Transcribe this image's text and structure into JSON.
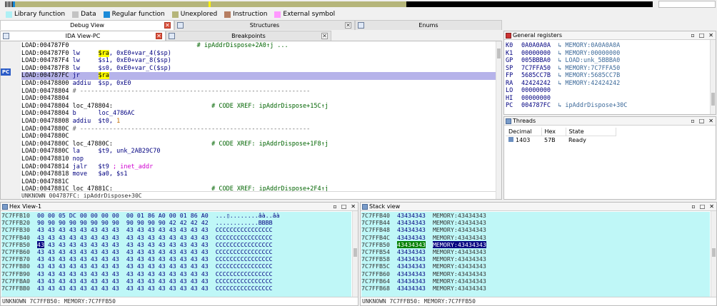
{
  "legend": [
    {
      "label": "Library function",
      "color": "#aef0f5"
    },
    {
      "label": "Data",
      "color": "#c3c3c3"
    },
    {
      "label": "Regular function",
      "color": "#1c8bd8"
    },
    {
      "label": "Unexplored",
      "color": "#b5b57a"
    },
    {
      "label": "Instruction",
      "color": "#b67e62"
    },
    {
      "label": "External symbol",
      "color": "#ff99ff"
    }
  ],
  "tabs_row1": [
    {
      "label": "Debug View",
      "active": true,
      "close": "red"
    },
    {
      "label": "Structures",
      "active": false,
      "close": "gray"
    },
    {
      "label": "Enums",
      "active": false,
      "close": "gray"
    }
  ],
  "tabs_row2": [
    {
      "label": "IDA View-PC",
      "active": true,
      "close": "red"
    },
    {
      "label": "Breakpoints",
      "active": false,
      "close": "gray"
    }
  ],
  "ida": {
    "pc_marker": "PC",
    "status": "UNKNOWN 004787FC: ipAddrDispose+30C",
    "lines": [
      [
        {
          "t": "LOAD:004787F0",
          "c": "addr"
        },
        {
          "t": "                                   # ipAddrDispose+2A0↑j ...",
          "c": "cmt"
        }
      ],
      [
        {
          "t": "LOAD:004787F0 ",
          "c": "addr"
        },
        {
          "t": "lw",
          "c": "mn"
        },
        {
          "t": "     ",
          "c": ""
        },
        {
          "t": "$ra",
          "c": "reg"
        },
        {
          "t": ", 0xE0+var_4($sp)",
          "c": "op"
        }
      ],
      [
        {
          "t": "LOAD:004787F4 ",
          "c": "addr"
        },
        {
          "t": "lw",
          "c": "mn"
        },
        {
          "t": "     $s1, 0xE0+var_8($sp)",
          "c": "op"
        }
      ],
      [
        {
          "t": "LOAD:004787F8 ",
          "c": "addr"
        },
        {
          "t": "lw",
          "c": "mn"
        },
        {
          "t": "     $s0, 0xE0+var_C($sp)",
          "c": "op"
        }
      ],
      [
        {
          "t": "LOAD:004787FC ",
          "c": "addr"
        },
        {
          "t": "jr",
          "c": "mn"
        },
        {
          "t": "     ",
          "c": ""
        },
        {
          "t": "$ra",
          "c": "reg"
        }
      ],
      [
        {
          "t": "LOAD:00478800 ",
          "c": "addr"
        },
        {
          "t": "addiu",
          "c": "mn"
        },
        {
          "t": "  $sp, 0xE0",
          "c": "op"
        }
      ],
      [
        {
          "t": "LOAD:00478804 ",
          "c": "addr"
        },
        {
          "t": "# ---------------------------------------------------------------",
          "c": "sep"
        }
      ],
      [
        {
          "t": "LOAD:00478804",
          "c": "addr"
        }
      ],
      [
        {
          "t": "LOAD:00478804 loc_478804:",
          "c": "loc"
        },
        {
          "t": "                           # CODE XREF: ipAddrDispose+15C↑j",
          "c": "cmt"
        }
      ],
      [
        {
          "t": "LOAD:00478804 ",
          "c": "addr"
        },
        {
          "t": "b",
          "c": "mn"
        },
        {
          "t": "      loc_4786AC",
          "c": "op"
        }
      ],
      [
        {
          "t": "LOAD:00478808 ",
          "c": "addr"
        },
        {
          "t": "addiu",
          "c": "mn"
        },
        {
          "t": "  $t0, ",
          "c": "op"
        },
        {
          "t": "1",
          "c": "ora"
        }
      ],
      [
        {
          "t": "LOAD:0047880C ",
          "c": "addr"
        },
        {
          "t": "# ---------------------------------------------------------------",
          "c": "sep"
        }
      ],
      [
        {
          "t": "LOAD:0047880C",
          "c": "addr"
        }
      ],
      [
        {
          "t": "LOAD:0047880C loc_47880C:",
          "c": "loc"
        },
        {
          "t": "                           # CODE XREF: ipAddrDispose+1F8↑j",
          "c": "cmt"
        }
      ],
      [
        {
          "t": "LOAD:0047880C ",
          "c": "addr"
        },
        {
          "t": "la",
          "c": "mn"
        },
        {
          "t": "     $t9, unk_2AB29C70",
          "c": "op"
        }
      ],
      [
        {
          "t": "LOAD:00478810 ",
          "c": "addr"
        },
        {
          "t": "nop",
          "c": "mn"
        }
      ],
      [
        {
          "t": "LOAD:00478814 ",
          "c": "addr"
        },
        {
          "t": "jalr",
          "c": "mn"
        },
        {
          "t": "   $t9 ",
          "c": "op"
        },
        {
          "t": "; inet_addr",
          "c": "kw"
        }
      ],
      [
        {
          "t": "LOAD:00478818 ",
          "c": "addr"
        },
        {
          "t": "move",
          "c": "mn"
        },
        {
          "t": "   $a0, $s1",
          "c": "op"
        }
      ],
      [
        {
          "t": "LOAD:0047881C",
          "c": "addr"
        }
      ],
      [
        {
          "t": "LOAD:0047881C loc_47881C:",
          "c": "loc"
        },
        {
          "t": "                           # CODE XREF: ipAddrDispose+2F4↑j",
          "c": "cmt"
        }
      ]
    ],
    "highlight_index": 4
  },
  "registers": {
    "title": "General registers",
    "rows": [
      {
        "name": "K0",
        "value": "0A0A0A0A",
        "mem": "↳ MEMORY:0A0A0A0A"
      },
      {
        "name": "K1",
        "value": "00000000",
        "mem": "↳ MEMORY:00000000"
      },
      {
        "name": "GP",
        "value": "005BBBA0",
        "mem": "↳ LOAD:unk_5BBBA0"
      },
      {
        "name": "SP",
        "value": "7C7FFA50",
        "mem": "↳ MEMORY:7C7FFA50"
      },
      {
        "name": "FP",
        "value": "5685CC7B",
        "mem": "↳ MEMORY:5685CC7B"
      },
      {
        "name": "RA",
        "value": "42424242",
        "mem": "↳ MEMORY:42424242"
      },
      {
        "name": "LO",
        "value": "00000000",
        "mem": ""
      },
      {
        "name": "HI",
        "value": "00000000",
        "mem": ""
      },
      {
        "name": "PC",
        "value": "004787FC",
        "mem": "↳ ipAddrDispose+30C"
      }
    ]
  },
  "threads": {
    "title": "Threads",
    "columns": [
      "Decimal",
      "Hex",
      "State"
    ],
    "rows": [
      {
        "decimal": "1403",
        "hex": "57B",
        "state": "Ready"
      }
    ]
  },
  "hexview": {
    "title": "Hex View-1",
    "status": "UNKNOWN 7C7FFB50: MEMORY:7C7FFB50",
    "rows": [
      {
        "addr": "7C7FFB10",
        "bytes": "00 00 05 DC 00 00 00 00  00 01 86 A0 00 01 86 A0",
        "ascii": "...▯........âà..âà"
      },
      {
        "addr": "7C7FFB20",
        "bytes": "90 90 90 90 90 90 90 90  90 90 90 90 42 42 42 42",
        "ascii": "............BBBB"
      },
      {
        "addr": "7C7FFB30",
        "bytes": "43 43 43 43 43 43 43 43  43 43 43 43 43 43 43 43",
        "ascii": "CCCCCCCCCCCCCCCC"
      },
      {
        "addr": "7C7FFB40",
        "bytes": "43 43 43 43 43 43 43 43  43 43 43 43 43 43 43 43",
        "ascii": "CCCCCCCCCCCCCCCC"
      },
      {
        "addr": "7C7FFB50",
        "bytes": "43 43 43 43 43 43 43 43  43 43 43 43 43 43 43 43",
        "ascii": "CCCCCCCCCCCCCCCC",
        "cursor": "43"
      },
      {
        "addr": "7C7FFB60",
        "bytes": "43 43 43 43 43 43 43 43  43 43 43 43 43 43 43 43",
        "ascii": "CCCCCCCCCCCCCCCC"
      },
      {
        "addr": "7C7FFB70",
        "bytes": "43 43 43 43 43 43 43 43  43 43 43 43 43 43 43 43",
        "ascii": "CCCCCCCCCCCCCCCC"
      },
      {
        "addr": "7C7FFB80",
        "bytes": "43 43 43 43 43 43 43 43  43 43 43 43 43 43 43 43",
        "ascii": "CCCCCCCCCCCCCCCC"
      },
      {
        "addr": "7C7FFB90",
        "bytes": "43 43 43 43 43 43 43 43  43 43 43 43 43 43 43 43",
        "ascii": "CCCCCCCCCCCCCCCC"
      },
      {
        "addr": "7C7FFBA0",
        "bytes": "43 43 43 43 43 43 43 43  43 43 43 43 43 43 43 43",
        "ascii": "CCCCCCCCCCCCCCCC"
      },
      {
        "addr": "7C7FFBB0",
        "bytes": "43 43 43 43 43 43 43 43  43 43 43 43 43 43 43 43",
        "ascii": "CCCCCCCCCCCCCCCC"
      }
    ]
  },
  "stackview": {
    "title": "Stack view",
    "status": "UNKNOWN 7C7FFB50: MEMORY:7C7FFB50",
    "rows": [
      {
        "addr": "7C7FFB40",
        "value": "43434343",
        "mem": "MEMORY:43434343"
      },
      {
        "addr": "7C7FFB44",
        "value": "43434343",
        "mem": "MEMORY:43434343"
      },
      {
        "addr": "7C7FFB48",
        "value": "43434343",
        "mem": "MEMORY:43434343"
      },
      {
        "addr": "7C7FFB4C",
        "value": "43434343",
        "mem": "MEMORY:43434343"
      },
      {
        "addr": "7C7FFB50",
        "value": "43434343",
        "mem": "MEMORY:43434343",
        "current": true
      },
      {
        "addr": "7C7FFB54",
        "value": "43434343",
        "mem": "MEMORY:43434343"
      },
      {
        "addr": "7C7FFB58",
        "value": "43434343",
        "mem": "MEMORY:43434343"
      },
      {
        "addr": "7C7FFB5C",
        "value": "43434343",
        "mem": "MEMORY:43434343"
      },
      {
        "addr": "7C7FFB60",
        "value": "43434343",
        "mem": "MEMORY:43434343"
      },
      {
        "addr": "7C7FFB64",
        "value": "43434343",
        "mem": "MEMORY:43434343"
      },
      {
        "addr": "7C7FFB68",
        "value": "43434343",
        "mem": "MEMORY:43434343"
      }
    ]
  },
  "panel_buttons": {
    "restore": "▫",
    "max": "□",
    "close": "✕"
  }
}
